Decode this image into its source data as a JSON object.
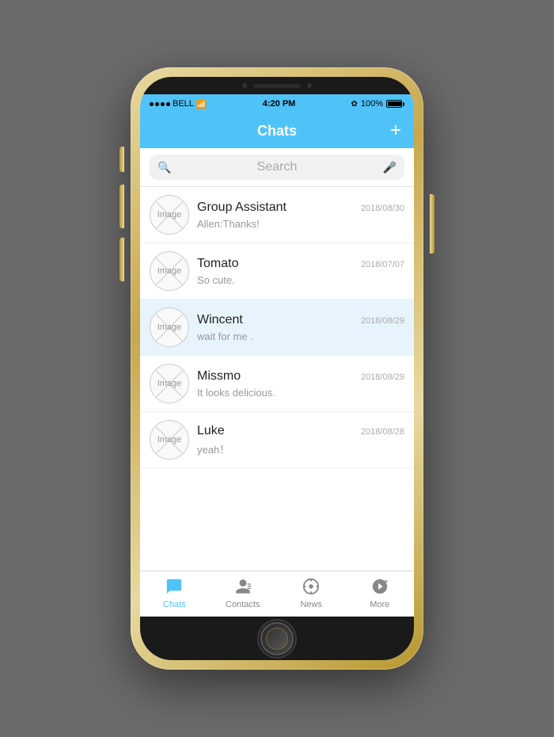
{
  "phone": {
    "status_bar": {
      "carrier": "BELL",
      "wifi": true,
      "time": "4:20 PM",
      "bluetooth": true,
      "battery": "100%"
    },
    "header": {
      "title": "Chats",
      "add_button": "+"
    },
    "search": {
      "placeholder": "Search"
    },
    "chat_list": [
      {
        "id": 1,
        "name": "Group Assistant",
        "preview": "Allen:Thanks!",
        "date": "2018/08/30",
        "avatar_label": "Image",
        "highlighted": false
      },
      {
        "id": 2,
        "name": "Tomato",
        "preview": "So cute.",
        "date": "2018/07/07",
        "avatar_label": "Image",
        "highlighted": false
      },
      {
        "id": 3,
        "name": "Wincent",
        "preview": "wait for me .",
        "date": "2018/08/29",
        "avatar_label": "Image",
        "highlighted": true
      },
      {
        "id": 4,
        "name": "Missmo",
        "preview": "It looks delicious.",
        "date": "2018/08/29",
        "avatar_label": "Image",
        "highlighted": false
      },
      {
        "id": 5,
        "name": "Luke",
        "preview": "yeah！",
        "date": "2018/08/28",
        "avatar_label": "Image",
        "highlighted": false
      }
    ],
    "tab_bar": {
      "tabs": [
        {
          "id": "chats",
          "label": "Chats",
          "active": true
        },
        {
          "id": "contacts",
          "label": "Contacts",
          "active": false
        },
        {
          "id": "news",
          "label": "News",
          "active": false
        },
        {
          "id": "more",
          "label": "More",
          "active": false
        }
      ]
    }
  }
}
